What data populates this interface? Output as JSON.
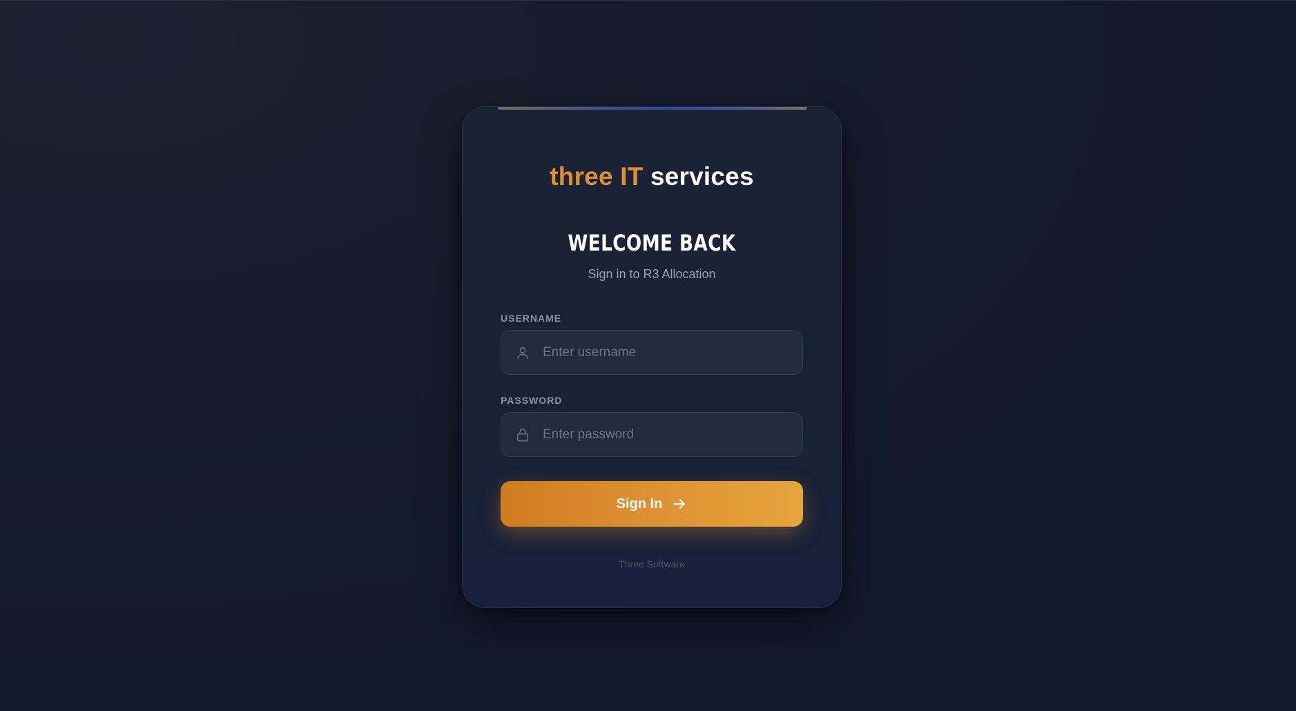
{
  "brand": {
    "word1": "three",
    "word2": "IT",
    "word3": "services",
    "accent_color": "#e08f2f"
  },
  "login": {
    "heading": "WELCOME BACK",
    "subtitle": "Sign in to R3 Allocation",
    "username_label": "USERNAME",
    "username_placeholder": "Enter username",
    "username_value": "",
    "username_icon": "user-icon",
    "password_label": "PASSWORD",
    "password_placeholder": "Enter password",
    "password_value": "",
    "password_icon": "lock-icon",
    "submit_label": "Sign In",
    "submit_icon": "arrow-right-icon",
    "button_color": "#dc8f31"
  },
  "footer": {
    "text": "Three Software"
  }
}
